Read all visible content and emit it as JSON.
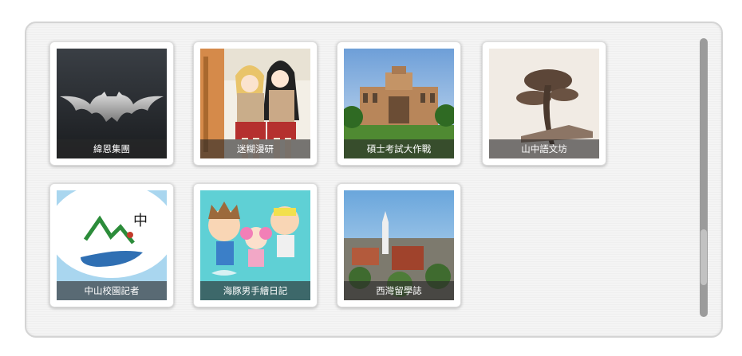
{
  "gallery": {
    "tiles": [
      {
        "label": "緯恩集團",
        "icon": "batman-logo"
      },
      {
        "label": "迷糊漫研",
        "icon": "anime-schoolgirls"
      },
      {
        "label": "碩士考試大作戰",
        "icon": "library-building"
      },
      {
        "label": "山中語文坊",
        "icon": "pine-tree"
      },
      {
        "label": "中山校園記者",
        "icon": "mountain-logo"
      },
      {
        "label": "海豚男手繪日記",
        "icon": "cartoon-kids"
      },
      {
        "label": "西灣留學誌",
        "icon": "campus-aerial"
      }
    ]
  },
  "colors": {
    "panel_background": "#f4f4f4",
    "caption_overlay": "#282828",
    "scrollbar": "#9b9b9b"
  }
}
